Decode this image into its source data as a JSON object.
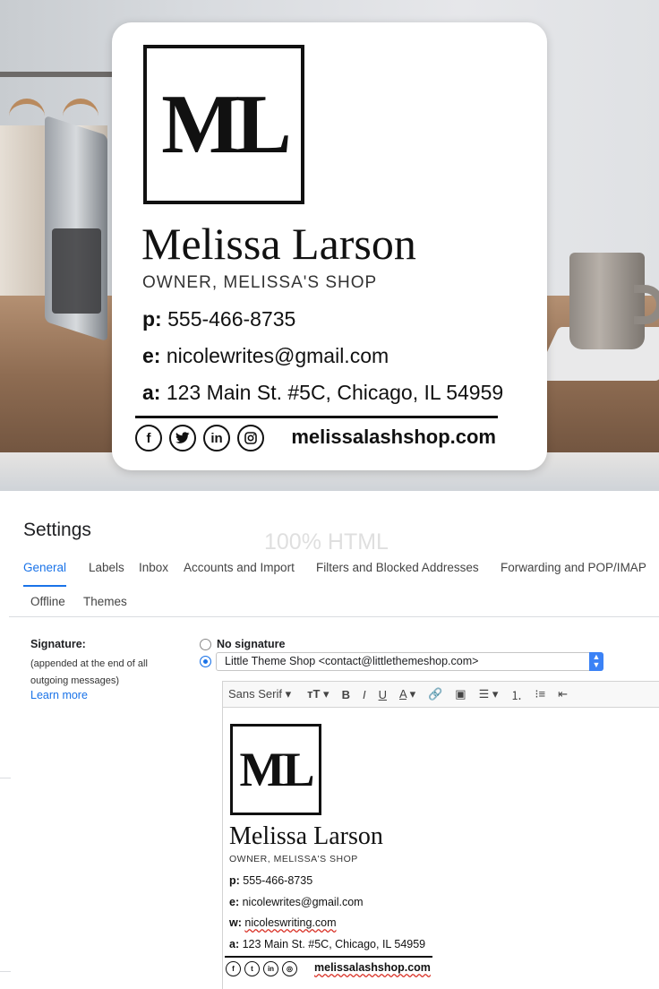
{
  "signature_card": {
    "logo": "ML",
    "name": "Melissa Larson",
    "role": "OWNER, MELISSA'S SHOP",
    "phone_label": "p:",
    "phone": "555-466-8735",
    "email_label": "e:",
    "email": "nicolewrites@gmail.com",
    "address_label": "a:",
    "address": "123 Main St. #5C, Chicago, IL 54959",
    "social_icons": [
      "facebook-icon",
      "twitter-icon",
      "linkedin-icon",
      "instagram-icon"
    ],
    "website": "melissalashshop.com"
  },
  "settings": {
    "title": "Settings",
    "watermark": "100% HTML",
    "tabs": [
      {
        "label": "General"
      },
      {
        "label": "Labels"
      },
      {
        "label": "Inbox"
      },
      {
        "label": "Accounts and Import"
      },
      {
        "label": "Filters and Blocked Addresses"
      },
      {
        "label": "Forwarding and POP/IMAP"
      },
      {
        "label": "Offline"
      },
      {
        "label": "Themes"
      }
    ],
    "signature_label": "Signature:",
    "signature_help": "(appended at the end of all outgoing messages)",
    "learn_more": "Learn more",
    "no_signature": "No signature",
    "selected_account": "Little Theme Shop <contact@littlethemeshop.com>",
    "toolbar": {
      "font": "Sans Serif"
    },
    "editor": {
      "logo": "ML",
      "name": "Melissa Larson",
      "role": "OWNER, MELISSA'S SHOP",
      "phone_label": "p:",
      "phone": "555-466-8735",
      "email_label": "e:",
      "email": "nicolewrites@gmail.com",
      "web_label": "w:",
      "web": "nicoleswriting.com",
      "address_label": "a:",
      "address": "123 Main St. #5C, Chicago, IL 54959",
      "website": "melissalashshop.com"
    }
  },
  "colors": {
    "accent": "#1a73e8",
    "text": "#202124",
    "signature_black": "#111111"
  }
}
